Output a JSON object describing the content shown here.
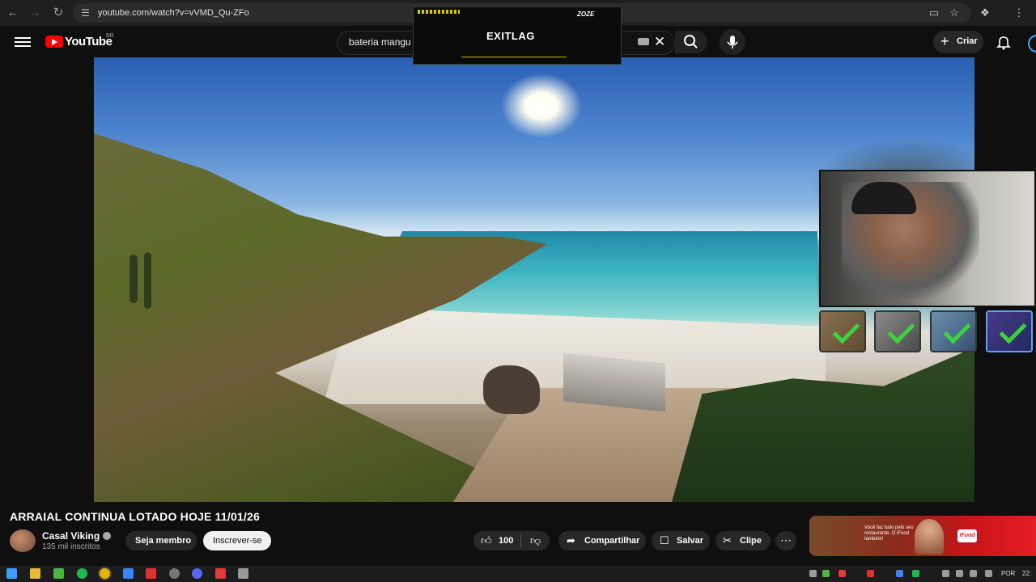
{
  "browser": {
    "url": "youtube.com/watch?v=vVMD_Qu-ZFo",
    "icons": [
      "back-icon",
      "forward-icon",
      "reload-icon",
      "site-info-icon",
      "install-icon",
      "bookmark-star-icon",
      "extensions-icon",
      "menu-dots-icon"
    ]
  },
  "header": {
    "logo_text": "YouTube",
    "country": "BR",
    "search_value": "bateria mangu",
    "create_label": "Criar"
  },
  "overlay_ad": {
    "logo": "EXITLAG",
    "brand": "ZOZE"
  },
  "video": {
    "title": "ARRAIAL CONTINUA LOTADO HOJE 11/01/26",
    "channel": "Casal Viking",
    "subscribers": "135 mil inscritos",
    "member_label": "Seja membro",
    "subscribe_label": "Inscrever-se",
    "likes": "100",
    "share_label": "Compartilhar",
    "save_label": "Salvar",
    "clip_label": "Clipe",
    "more_label": "⋯"
  },
  "side_ad": {
    "text": "Você faz tudo pelo seu restaurante. O iFood também!",
    "logo": "iFood"
  },
  "taskbar": {
    "language": "POR",
    "time": "22:"
  },
  "colors": {
    "youtube_red": "#ff0000",
    "badge_check": "#3dd13d",
    "ifood_red": "#e41d25"
  }
}
